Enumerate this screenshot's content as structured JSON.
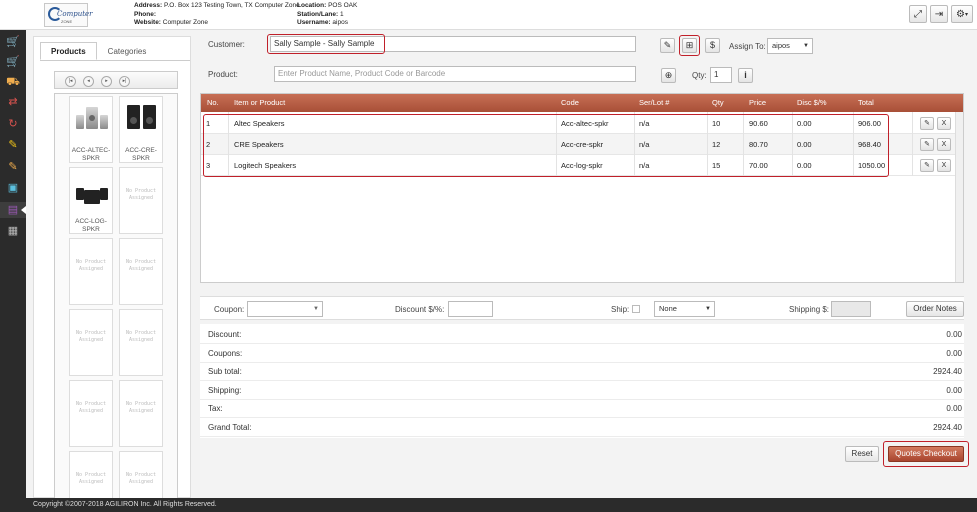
{
  "header": {
    "logo_text": "Computer",
    "logo_sub": "ZONE",
    "address_label": "Address:",
    "address_value": "P.O. Box 123 Testing Town, TX Computer Zone",
    "phone_label": "Phone:",
    "phone_value": "",
    "website_label": "Website:",
    "website_value": "Computer Zone",
    "location_label": "Location:",
    "location_value": "POS OAK",
    "station_label": "Station/Lane:",
    "station_value": "1",
    "username_label": "Username:",
    "username_value": "aipos"
  },
  "tabs": [
    {
      "label": "Products"
    },
    {
      "label": "Categories"
    }
  ],
  "product_grid": [
    {
      "name": "ACC-ALTEC-SPKR",
      "icon": "altec-speaker-image"
    },
    {
      "name": "ACC-CRE-SPKR",
      "icon": "cre-speaker-image"
    },
    {
      "name": "ACC-LOG-SPKR",
      "icon": "logitech-speaker-image"
    },
    {
      "name": "No Product Assigned"
    },
    {
      "name": "No Product Assigned"
    },
    {
      "name": "No Product Assigned"
    },
    {
      "name": "No Product Assigned"
    },
    {
      "name": "No Product Assigned"
    },
    {
      "name": "No Product Assigned"
    },
    {
      "name": "No Product Assigned"
    },
    {
      "name": "No Product Assigned"
    },
    {
      "name": "No Product Assigned"
    }
  ],
  "form": {
    "customer_label": "Customer:",
    "customer_value": "Sally Sample - Sally Sample",
    "assign_label": "Assign To:",
    "assign_value": "aipos",
    "product_label": "Product:",
    "product_placeholder": "Enter Product Name, Product Code or Barcode",
    "qty_label": "Qty:",
    "qty_value": "1",
    "dollar_symbol": "$",
    "info_symbol": "i"
  },
  "table": {
    "headers": [
      "No.",
      "Item or Product",
      "Code",
      "Ser/Lot #",
      "Qty",
      "Price",
      "Disc $/%",
      "Total"
    ],
    "rows": [
      {
        "no": "1",
        "item": "Altec Speakers",
        "code": "Acc-altec-spkr",
        "serial": "n/a",
        "qty": "10",
        "price": "90.60",
        "disc": "0.00",
        "total": "906.00"
      },
      {
        "no": "2",
        "item": "CRE Speakers",
        "code": "Acc-cre-spkr",
        "serial": "n/a",
        "qty": "12",
        "price": "80.70",
        "disc": "0.00",
        "total": "968.40"
      },
      {
        "no": "3",
        "item": "Logitech Speakers",
        "code": "Acc-log-spkr",
        "serial": "n/a",
        "qty": "15",
        "price": "70.00",
        "disc": "0.00",
        "total": "1050.00"
      }
    ],
    "remove_label": "X"
  },
  "summary_bar": {
    "coupon_label": "Coupon:",
    "discount_label": "Discount $/%:",
    "ship_label": "Ship:",
    "ship_method": "None",
    "shipping_label": "Shipping $:",
    "order_notes_label": "Order Notes"
  },
  "totals": [
    {
      "label": "Discount:",
      "value": "0.00"
    },
    {
      "label": "Coupons:",
      "value": "0.00"
    },
    {
      "label": "Sub total:",
      "value": "2924.40"
    },
    {
      "label": "Shipping:",
      "value": "0.00"
    },
    {
      "label": "Tax:",
      "value": "0.00"
    },
    {
      "label": "Grand Total:",
      "value": "2924.40"
    }
  ],
  "actions": {
    "reset_label": "Reset",
    "checkout_label": "Quotes Checkout"
  },
  "footer": {
    "copyright": "Copyright ©2007-2018 AGILIRON Inc. All Rights Reserved."
  },
  "colors": {
    "accent": "#b85a41",
    "highlight": "#c0202a",
    "nav_bg": "#2b2b2b"
  }
}
